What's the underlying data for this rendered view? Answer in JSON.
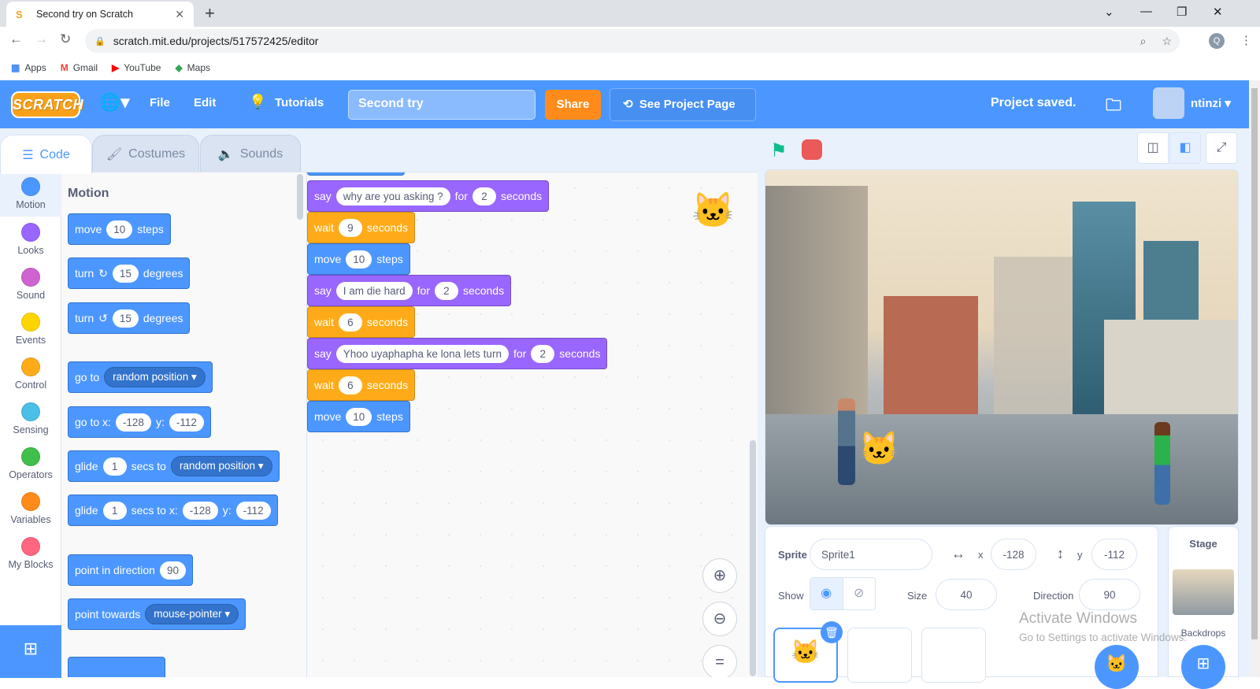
{
  "browser": {
    "tab_title": "Second try on Scratch",
    "tab_favicon": "S",
    "url": "scratch.mit.edu/projects/517572425/editor",
    "profile_initial": "Q",
    "bookmarks": [
      {
        "label": "Apps",
        "icon": "apps-icon"
      },
      {
        "label": "Gmail",
        "icon": "gmail-icon"
      },
      {
        "label": "YouTube",
        "icon": "youtube-icon"
      },
      {
        "label": "Maps",
        "icon": "maps-icon"
      }
    ]
  },
  "menubar": {
    "logo": "SCRATCH",
    "file": "File",
    "edit": "Edit",
    "tutorials": "Tutorials",
    "project_title": "Second try",
    "share": "Share",
    "see_project_page": "See Project Page",
    "status": "Project saved.",
    "username": "ntinzi"
  },
  "tabs": {
    "code": "Code",
    "costumes": "Costumes",
    "sounds": "Sounds"
  },
  "categories": [
    {
      "label": "Motion",
      "color": "#4c97ff"
    },
    {
      "label": "Looks",
      "color": "#9966ff"
    },
    {
      "label": "Sound",
      "color": "#cf63cf"
    },
    {
      "label": "Events",
      "color": "#ffd500"
    },
    {
      "label": "Control",
      "color": "#ffab19"
    },
    {
      "label": "Sensing",
      "color": "#4cbfe6"
    },
    {
      "label": "Operators",
      "color": "#40bf4a"
    },
    {
      "label": "Variables",
      "color": "#ff8c1a"
    },
    {
      "label": "My Blocks",
      "color": "#ff6680"
    }
  ],
  "palette": {
    "title": "Motion",
    "move": {
      "a": "move",
      "v": "10",
      "b": "steps"
    },
    "turn_right": {
      "a": "turn",
      "v": "15",
      "b": "degrees"
    },
    "turn_left": {
      "a": "turn",
      "v": "15",
      "b": "degrees"
    },
    "goto": {
      "a": "go to",
      "dd": "random position"
    },
    "gotoxy": {
      "a": "go to x:",
      "x": "-128",
      "yl": "y:",
      "y": "-112"
    },
    "glide_to": {
      "a": "glide",
      "v": "1",
      "b": "secs to",
      "dd": "random position"
    },
    "glide_xy": {
      "a": "glide",
      "v": "1",
      "b": "secs to x:",
      "x": "-128",
      "yl": "y:",
      "y": "-112"
    },
    "point_dir": {
      "a": "point in direction",
      "v": "90"
    },
    "point_towards": {
      "a": "point towards",
      "dd": "mouse-pointer"
    }
  },
  "script": [
    {
      "type": "say",
      "kw": "say",
      "text": "why are you asking ?",
      "for": "for",
      "secs": "2",
      "unit": "seconds"
    },
    {
      "type": "wait",
      "kw": "wait",
      "secs": "9",
      "unit": "seconds"
    },
    {
      "type": "move",
      "kw": "move",
      "steps": "10",
      "unit": "steps"
    },
    {
      "type": "say",
      "kw": "say",
      "text": "I am die hard",
      "for": "for",
      "secs": "2",
      "unit": "seconds"
    },
    {
      "type": "wait",
      "kw": "wait",
      "secs": "6",
      "unit": "seconds"
    },
    {
      "type": "say",
      "kw": "say",
      "text": "Yhoo uyaphapha ke lona lets turn",
      "for": "for",
      "secs": "2",
      "unit": "seconds"
    },
    {
      "type": "wait",
      "kw": "wait",
      "secs": "6",
      "unit": "seconds"
    },
    {
      "type": "move",
      "kw": "move",
      "steps": "10",
      "unit": "steps"
    }
  ],
  "sprite_info": {
    "sprite_label": "Sprite",
    "sprite_name": "Sprite1",
    "x_label": "x",
    "x": "-128",
    "y_label": "y",
    "y": "-112",
    "show_label": "Show",
    "size_label": "Size",
    "size": "40",
    "direction_label": "Direction",
    "direction": "90"
  },
  "stage_pane": {
    "title": "Stage",
    "backdrops": "Backdrops"
  },
  "watermark": {
    "line1": "Activate Windows",
    "line2": "Go to Settings to activate Windows."
  }
}
